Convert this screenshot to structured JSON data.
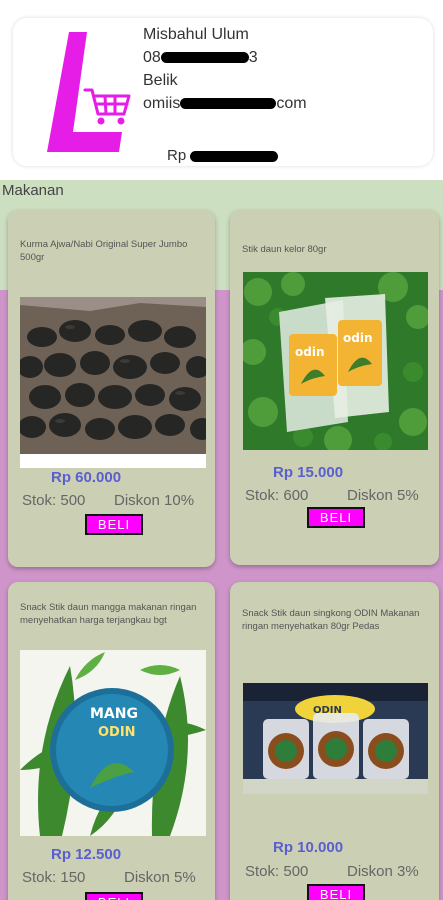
{
  "profile": {
    "name": "Misbahul Ulum",
    "phone_start": "08",
    "phone_end": "3",
    "city": "Belik",
    "email_start": "omiis",
    "email_end": "com",
    "balance_prefix": "Rp"
  },
  "section": {
    "title": "Makanan"
  },
  "products": [
    {
      "name": "Kurma Ajwa/Nabi Original Super Jumbo 500gr",
      "price": "Rp 60.000",
      "stock": "Stok: 500",
      "discount": "Diskon 10%",
      "buy_label": "BELI"
    },
    {
      "name": "Stik daun kelor 80gr",
      "price": "Rp 15.000",
      "stock": "Stok: 600",
      "discount": "Diskon 5%",
      "buy_label": "BELI"
    },
    {
      "name": "Snack Stik daun mangga makanan ringan menyehatkan harga terjangkau bgt",
      "price": "Rp 12.500",
      "stock": "Stok: 150",
      "discount": "Diskon 5%",
      "buy_label": "BELI",
      "image_text": "MANG",
      "image_brand": "ODIN"
    },
    {
      "name": "Snack Stik daun singkong ODIN Makanan ringan menyehatkan 80gr Pedas",
      "price": "Rp 10.000",
      "stock": "Stok: 500",
      "discount": "Diskon 3%",
      "buy_label": "BELI"
    }
  ],
  "colors": {
    "accent": "#ff00ff",
    "price": "#5a5fd0",
    "card": "#cbcfb3",
    "section_bg": "#cf95ca",
    "band": "#ccdfc0"
  }
}
